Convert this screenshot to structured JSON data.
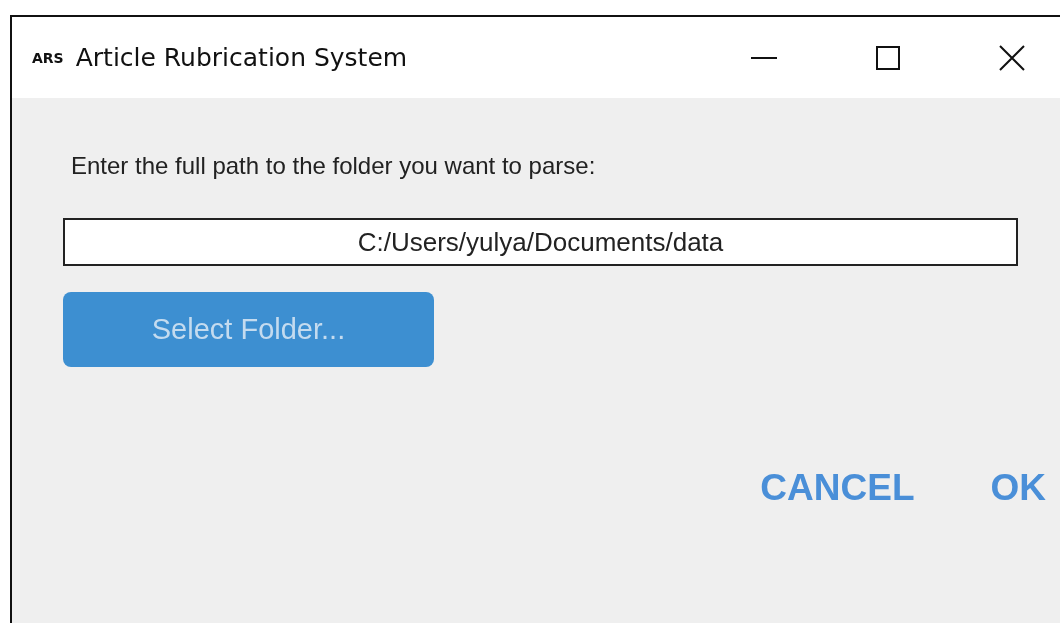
{
  "window": {
    "logo": "ARS",
    "title": "Article Rubrication System"
  },
  "prompt": "Enter the full path to the folder you want to parse:",
  "path_field": {
    "value": "C:/Users/yulya/Documents/data"
  },
  "select_button": {
    "label": "Select Folder...",
    "disabled": true
  },
  "buttons": [
    {
      "label": "CANCEL"
    },
    {
      "label": "OK"
    }
  ]
}
